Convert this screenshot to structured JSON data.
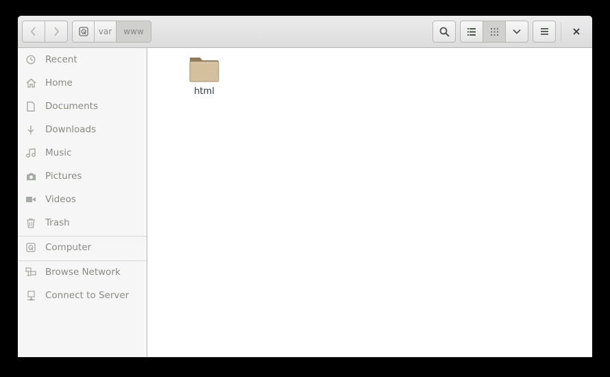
{
  "toolbar": {
    "path": [
      {
        "label": "",
        "icon": "disk-icon"
      },
      {
        "label": "var"
      },
      {
        "label": "www"
      }
    ]
  },
  "sidebar": {
    "places": [
      {
        "label": "Recent",
        "icon": "clock-icon"
      },
      {
        "label": "Home",
        "icon": "home-icon"
      },
      {
        "label": "Documents",
        "icon": "document-icon"
      },
      {
        "label": "Downloads",
        "icon": "download-icon"
      },
      {
        "label": "Music",
        "icon": "music-icon"
      },
      {
        "label": "Pictures",
        "icon": "camera-icon"
      },
      {
        "label": "Videos",
        "icon": "video-icon"
      },
      {
        "label": "Trash",
        "icon": "trash-icon"
      }
    ],
    "devices": [
      {
        "label": "Computer",
        "icon": "disk-icon"
      }
    ],
    "network": [
      {
        "label": "Browse Network",
        "icon": "network-icon"
      },
      {
        "label": "Connect to Server",
        "icon": "server-icon"
      }
    ]
  },
  "content": {
    "files": [
      {
        "name": "html",
        "type": "folder"
      }
    ]
  },
  "colors": {
    "folder": "#d5c09e",
    "selected_toggle": "#d0d0ce",
    "sidebar_bg": "#f6f6f6",
    "text_dim": "#888a85"
  }
}
